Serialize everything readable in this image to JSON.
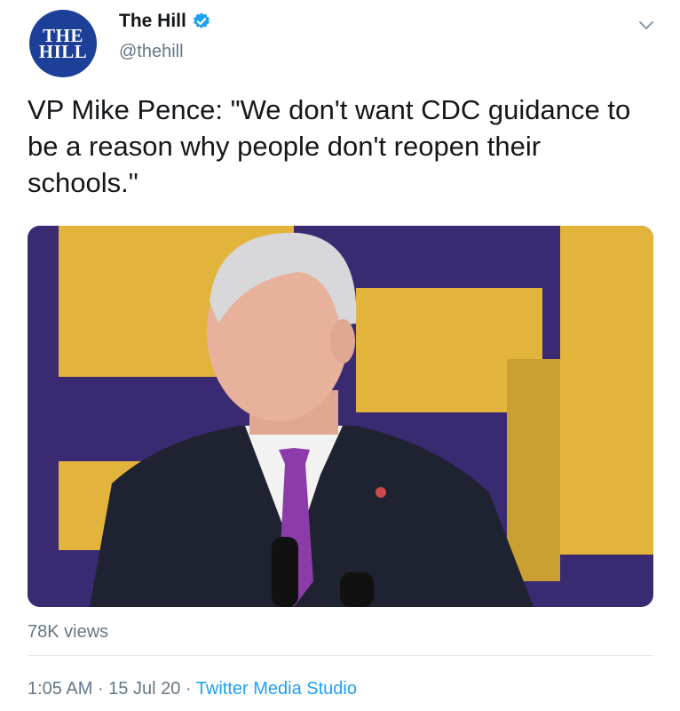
{
  "tweet": {
    "author": {
      "avatar_text_line1": "THE",
      "avatar_text_line2": "HILL",
      "display_name": "The Hill",
      "handle": "@thehill",
      "verified": true
    },
    "text": "VP Mike Pence: \"We don't want CDC guidance to be a reason why people don't reopen their schools.\"",
    "media": {
      "type": "video-still",
      "description_icon": "video-thumbnail"
    },
    "views": "78K views",
    "time": "1:05 AM",
    "separator": "·",
    "date": "15 Jul 20",
    "source": "Twitter Media Studio"
  },
  "colors": {
    "brand_avatar": "#1c3f98",
    "verified": "#1da1f2",
    "link": "#1da1f2",
    "secondary_text": "#657786",
    "backdrop_purple": "#3a2a72",
    "backdrop_yellow": "#e2b43c"
  }
}
